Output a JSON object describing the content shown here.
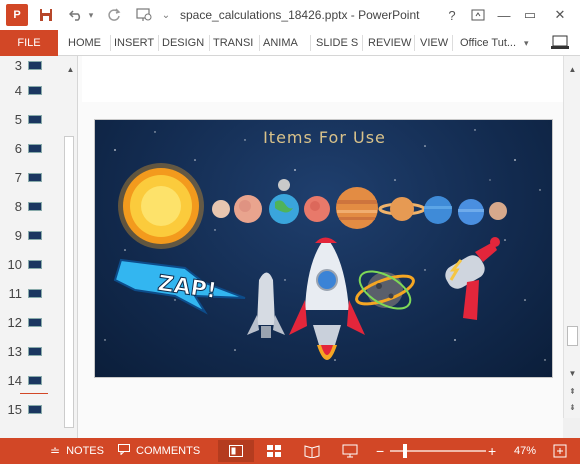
{
  "window": {
    "title": "space_calculations_18426.pptx - PowerPoint",
    "app_logo": "P",
    "help": "?",
    "minimize": "—",
    "restore": "▭",
    "close": "✕"
  },
  "qat": {
    "save_icon": "floppy-disk",
    "undo_icon": "undo-arrow",
    "redo_icon": "redo-arrow",
    "present_icon": "start-from-beginning",
    "more": "⌄"
  },
  "ribbon": {
    "file": "FILE",
    "tabs": [
      "HOME",
      "INSERT",
      "DESIGN",
      "TRANSI",
      "ANIMA",
      "SLIDE S",
      "REVIEW",
      "VIEW"
    ],
    "user": "Office Tut...",
    "user_caret": "▾"
  },
  "thumbnails": [
    "3",
    "4",
    "5",
    "6",
    "7",
    "8",
    "9",
    "10",
    "11",
    "12",
    "13",
    "14",
    "15"
  ],
  "slide": {
    "title": "Items For Use",
    "zap_text": "ZAP!"
  },
  "statusbar": {
    "notes": "NOTES",
    "comments": "COMMENTS",
    "zoom_minus": "−",
    "zoom_plus": "+",
    "zoom_level": "47%",
    "zoom_fraction": 0.47
  },
  "colors": {
    "accent": "#d24726",
    "sky": "#132c52"
  }
}
